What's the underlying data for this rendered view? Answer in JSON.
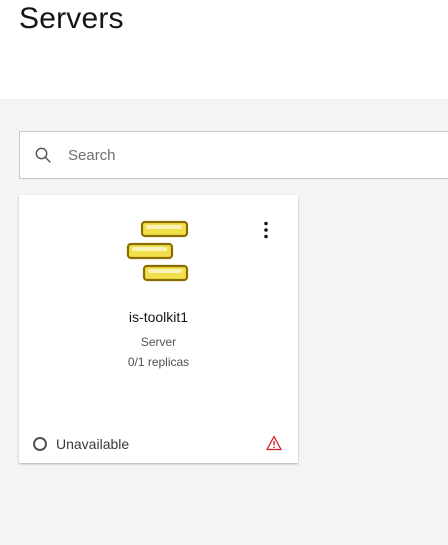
{
  "page": {
    "title": "Servers"
  },
  "search": {
    "placeholder": "Search",
    "value": "",
    "icon": "search-icon"
  },
  "cards": [
    {
      "name": "is-toolkit1",
      "type": "Server",
      "replicas": "0/1 replicas",
      "status": "Unavailable",
      "icon": "server-icon",
      "warning_icon": "warning-icon",
      "colors": {
        "icon_fill": "#f1e04b",
        "icon_stroke": "#8a6d00",
        "warning": "#da1e28",
        "status": "#525252"
      }
    }
  ]
}
